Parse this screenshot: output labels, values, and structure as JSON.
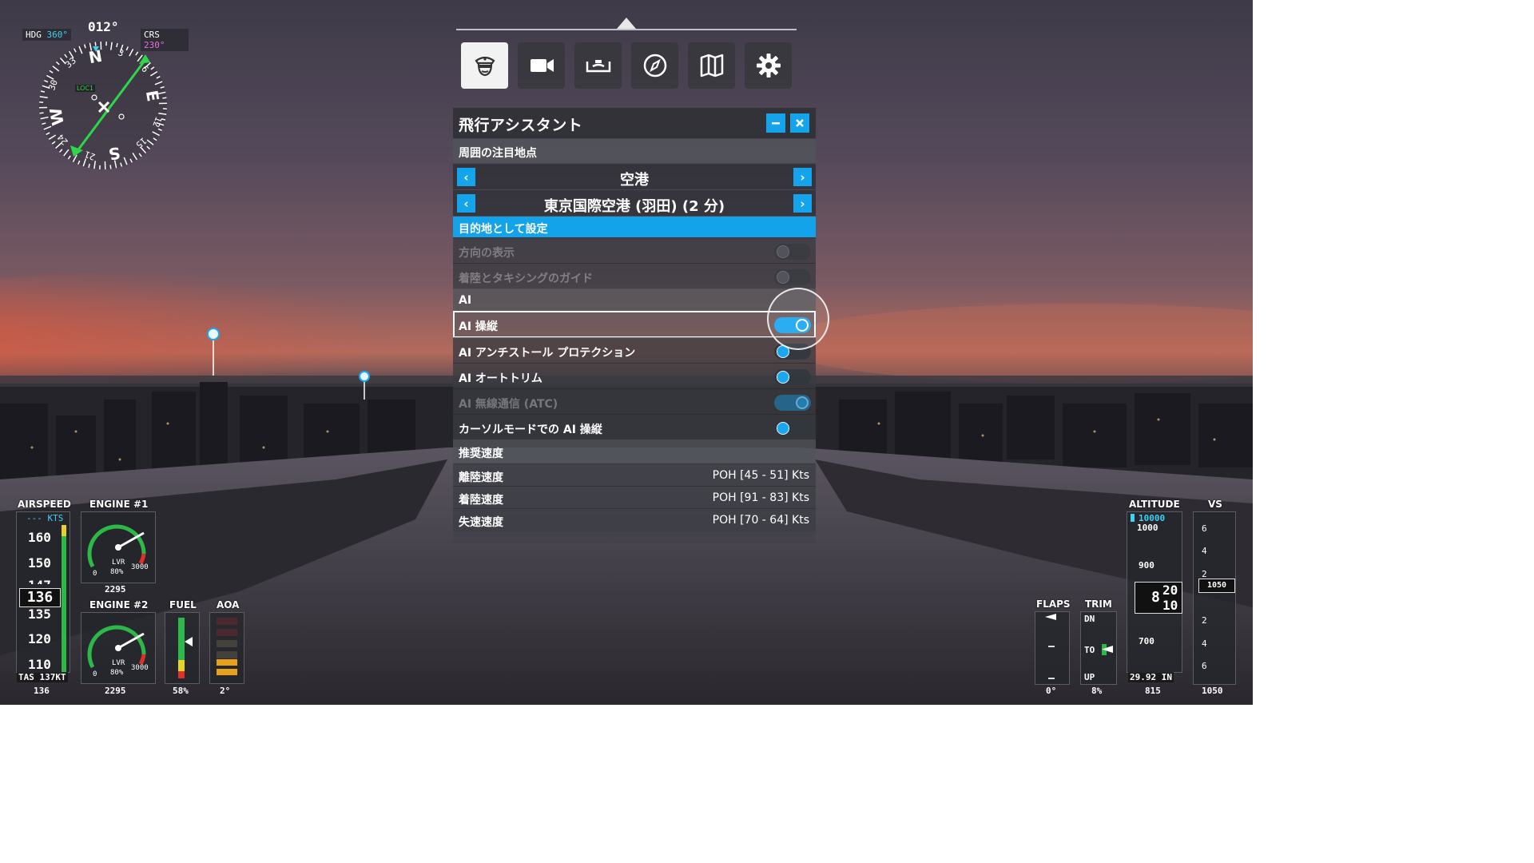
{
  "compass": {
    "hdg_label": "HDG",
    "hdg_value": "360°",
    "heading": "012°",
    "crs_label": "CRS",
    "crs_value": "230°",
    "loc_label": "LOC1",
    "cardinal_n": "N",
    "cardinal_e": "E",
    "cardinal_s": "S",
    "cardinal_w": "W",
    "tick_3": "3",
    "tick_6": "6",
    "tick_12": "12",
    "tick_15": "15",
    "tick_21": "21",
    "tick_24": "24",
    "tick_30": "30",
    "tick_33": "33"
  },
  "toolbar": {
    "buttons": [
      {
        "icon": "pilot-icon",
        "active": true
      },
      {
        "icon": "camera-icon",
        "active": false
      },
      {
        "icon": "yoke-icon",
        "active": false
      },
      {
        "icon": "compass-icon",
        "active": false
      },
      {
        "icon": "map-icon",
        "active": false
      },
      {
        "icon": "gear-icon",
        "active": false
      }
    ]
  },
  "panel": {
    "title": "飛行アシスタント",
    "poi_section": "周囲の注目地点",
    "category": "空港",
    "airport": "東京国際空港 (羽田) (2 分)",
    "set_destination": "目的地として設定",
    "show_direction": "方向の表示",
    "landing_taxi_guide": "着陸とタキシングのガイド",
    "ai_section": "AI",
    "ai_control": "AI 操縦",
    "ai_anti_stall": "AI アンチストール プロテクション",
    "ai_auto_trim": "AI オートトリム",
    "ai_atc": "AI 無線通信 (ATC)",
    "ai_cursor_mode": "カーソルモードでの AI 操縦",
    "speed_section": "推奨速度",
    "takeoff_label": "離陸速度",
    "takeoff_value": "POH [45 - 51] Kts",
    "landing_label": "着陸速度",
    "landing_value": "POH [91 - 83] Kts",
    "stall_label": "失速速度",
    "stall_value": "POH [70 - 64] Kts"
  },
  "airspeed": {
    "label": "AIRSPEED",
    "unit": "--- KTS",
    "t160": "160",
    "t150": "150",
    "t147": "147",
    "t135": "135",
    "t120": "120",
    "t110": "110",
    "current": "136",
    "tas": "TAS 137KT",
    "bottom": "136"
  },
  "engine1": {
    "label": "ENGINE #1",
    "lvr": "LVR",
    "pct": "80%",
    "min": "0",
    "max": "3000",
    "rpm": "2295"
  },
  "engine2": {
    "label": "ENGINE #2",
    "lvr": "LVR",
    "pct": "80%",
    "min": "0",
    "max": "3000",
    "rpm": "2295"
  },
  "fuel": {
    "label": "FUEL",
    "value": "58%"
  },
  "aoa": {
    "label": "AOA",
    "value": "2°"
  },
  "flaps": {
    "label": "FLAPS",
    "value": "0°"
  },
  "trim": {
    "label": "TRIM",
    "dn": "DN",
    "to": "TO",
    "up": "UP",
    "value": "8%"
  },
  "altitude": {
    "label": "ALTITUDE",
    "selected": "10000",
    "t1000": "1000",
    "t900": "900",
    "t700": "700",
    "current_hundreds": "8",
    "current_top": "20",
    "current_bottom": "10",
    "baro": "29.92 IN",
    "bottom": "815"
  },
  "vs": {
    "label": "VS",
    "t6a": "6",
    "t4a": "4",
    "t2a": "2",
    "t2b": "2",
    "t4b": "4",
    "t6b": "6",
    "current": "1050",
    "bottom": "1050"
  },
  "colors": {
    "accent": "#13a4ec",
    "gauge_green": "#2db84a",
    "gauge_red": "#e0302a"
  }
}
